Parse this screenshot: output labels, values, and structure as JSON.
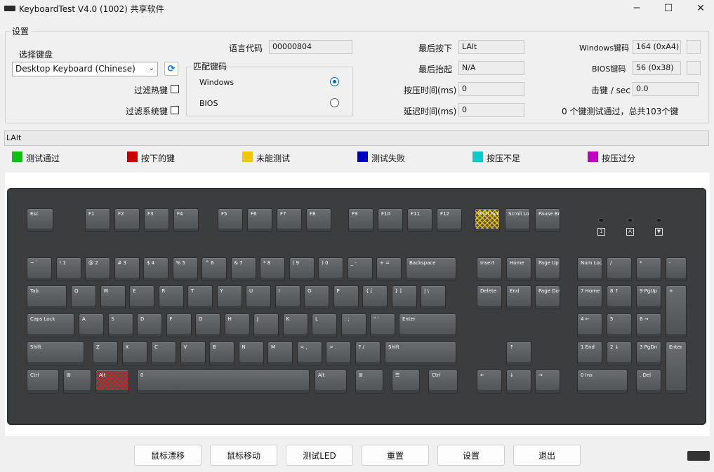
{
  "window": {
    "title": "KeyboardTest V4.0 (1002) 共享软件",
    "minimize": "─",
    "maximize": "☐",
    "close": "✕"
  },
  "settings": {
    "group_label": "设置",
    "select_keyboard_label": "选择键盘",
    "keyboard_value": "Desktop Keyboard (Chinese)",
    "filter_hotkeys_label": "过滤热键",
    "filter_system_keys_label": "过滤系统键",
    "language_code_label": "语言代码",
    "language_code_value": "00000804",
    "match_group_label": "匹配键码",
    "match_options": [
      {
        "label": "Windows",
        "selected": true
      },
      {
        "label": "BIOS",
        "selected": false
      }
    ],
    "last_down_label": "最后按下",
    "last_down_value": "LAlt",
    "last_up_label": "最后抬起",
    "last_up_value": "N/A",
    "press_time_label": "按压时间(ms)",
    "press_time_value": "0",
    "delay_time_label": "延迟时间(ms)",
    "delay_time_value": "0",
    "windows_code_label": "Windows键码",
    "windows_code_value": "164 (0xA4)",
    "bios_code_label": "BIOS键码",
    "bios_code_value": "56 (0x38)",
    "kps_label": "击键 / sec",
    "kps_value": "0.0",
    "summary": "0 个键测试通过，总共103个键"
  },
  "status_line": "LAlt",
  "legend": [
    {
      "label": "测试通过",
      "color": "#10c010"
    },
    {
      "label": "按下的键",
      "color": "#c80000"
    },
    {
      "label": "未能测试",
      "color": "#f0c800"
    },
    {
      "label": "测试失败",
      "color": "#0000c0"
    },
    {
      "label": "按压不足",
      "color": "#10c8c8"
    },
    {
      "label": "按压过分",
      "color": "#c000c0"
    }
  ],
  "keys": {
    "esc": "Esc",
    "f": [
      "F1",
      "F2",
      "F3",
      "F4",
      "F5",
      "F6",
      "F7",
      "F8",
      "F9",
      "F10",
      "F11",
      "F12"
    ],
    "prtsc": "Print Screen SysRq",
    "scroll": "Scroll Lock",
    "pause": "Pause Break",
    "row1": [
      "~ `",
      "! 1",
      "@ 2",
      "# 3",
      "$ 4",
      "% 5",
      "^ 6",
      "& 7",
      "* 8",
      "( 9",
      ") 0",
      "_ -",
      "+ ="
    ],
    "backspace": "Backspace",
    "tab": "Tab",
    "row2": [
      "Q",
      "W",
      "E",
      "R",
      "T",
      "Y",
      "U",
      "I",
      "O",
      "P",
      "{ [",
      "} ]",
      "| \\"
    ],
    "caps": "Caps Lock",
    "row3": [
      "A",
      "S",
      "D",
      "F",
      "G",
      "H",
      "J",
      "K",
      "L",
      ": ;",
      "\" '"
    ],
    "enter": "Enter",
    "shift": "Shift",
    "row4": [
      "Z",
      "X",
      "C",
      "V",
      "B",
      "N",
      "M",
      "< ,",
      "> .",
      "? /"
    ],
    "ctrl": "Ctrl",
    "alt": "Alt",
    "space_num": "0",
    "ins_group": [
      "Insert",
      "Home",
      "Page Up",
      "Delete",
      "End",
      "Page Down"
    ],
    "arrows": [
      "↑",
      "←",
      "↓",
      "→"
    ],
    "num": [
      "Num Lock",
      "/",
      "*",
      "-",
      "7 Home",
      "8 ↑",
      "9 PgUp",
      "+",
      "4 ←",
      "5",
      "6 →",
      "1 End",
      "2 ↓",
      "3 PgDn",
      "Enter",
      "0 Ins",
      ". Del"
    ]
  },
  "buttons": [
    "鼠标漂移",
    "鼠标移动",
    "测试LED",
    "重置",
    "设置",
    "退出"
  ]
}
